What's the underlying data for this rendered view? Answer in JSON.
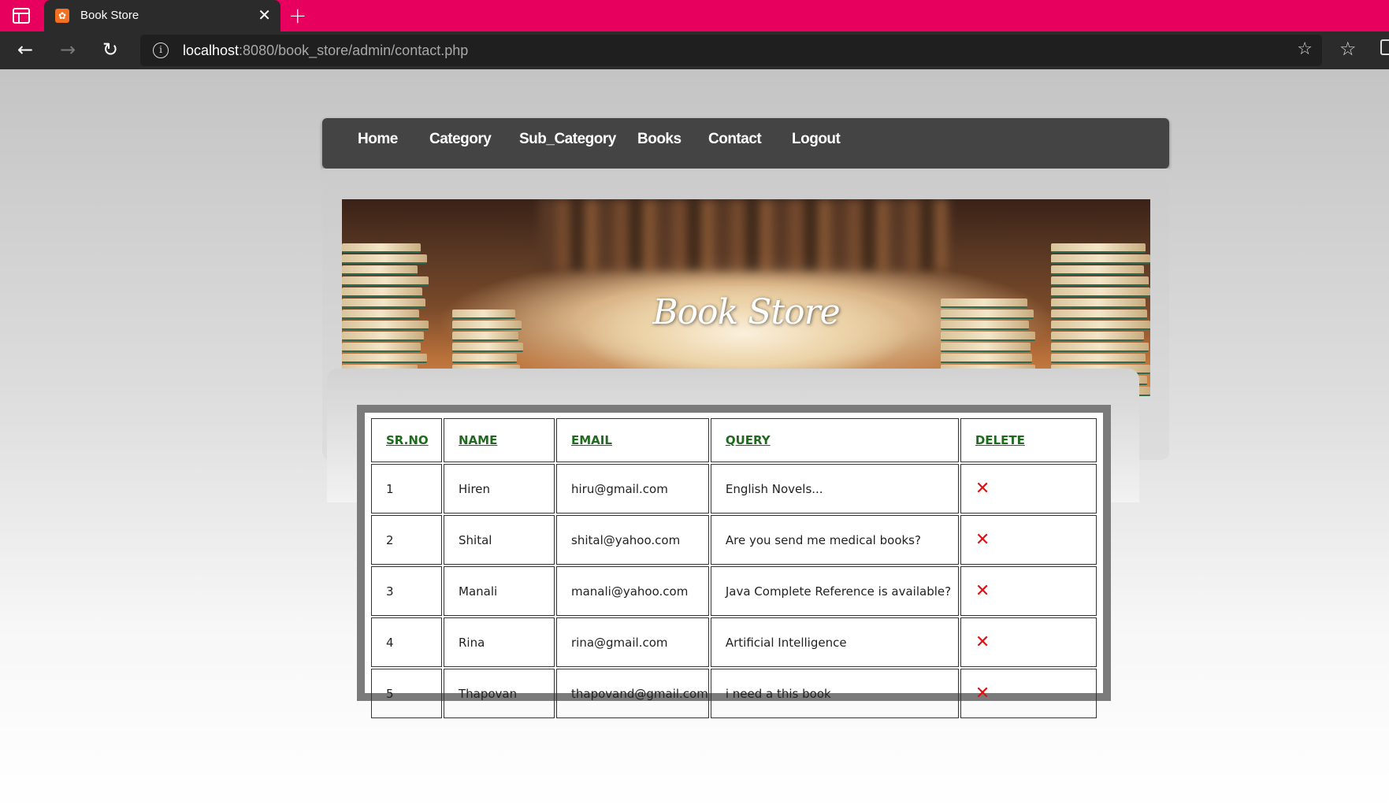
{
  "browser": {
    "tab_title": "Book Store",
    "url_host": "localhost",
    "url_rest": ":8080/book_store/admin/contact.php"
  },
  "menu": {
    "items": [
      "Home",
      "Category",
      "Sub_Category",
      "Books",
      "Contact",
      "Logout"
    ]
  },
  "banner": {
    "title": "Book Store"
  },
  "table": {
    "headers": [
      "SR.NO",
      "NAME",
      "EMAIL",
      "QUERY",
      "DELETE"
    ],
    "rows": [
      {
        "sr": "1",
        "name": "Hiren",
        "email": "hiru@gmail.com",
        "query": "English Novels..."
      },
      {
        "sr": "2",
        "name": "Shital",
        "email": "shital@yahoo.com",
        "query": "Are you send me medical books?"
      },
      {
        "sr": "3",
        "name": "Manali",
        "email": "manali@yahoo.com",
        "query": "Java Complete Reference is available?"
      },
      {
        "sr": "4",
        "name": "Rina",
        "email": "rina@gmail.com",
        "query": "Artificial Intelligence"
      },
      {
        "sr": "5",
        "name": "Thapovan",
        "email": "thapovand@gmail.com",
        "query": "i need a this book"
      }
    ],
    "delete_glyph": "✕"
  }
}
